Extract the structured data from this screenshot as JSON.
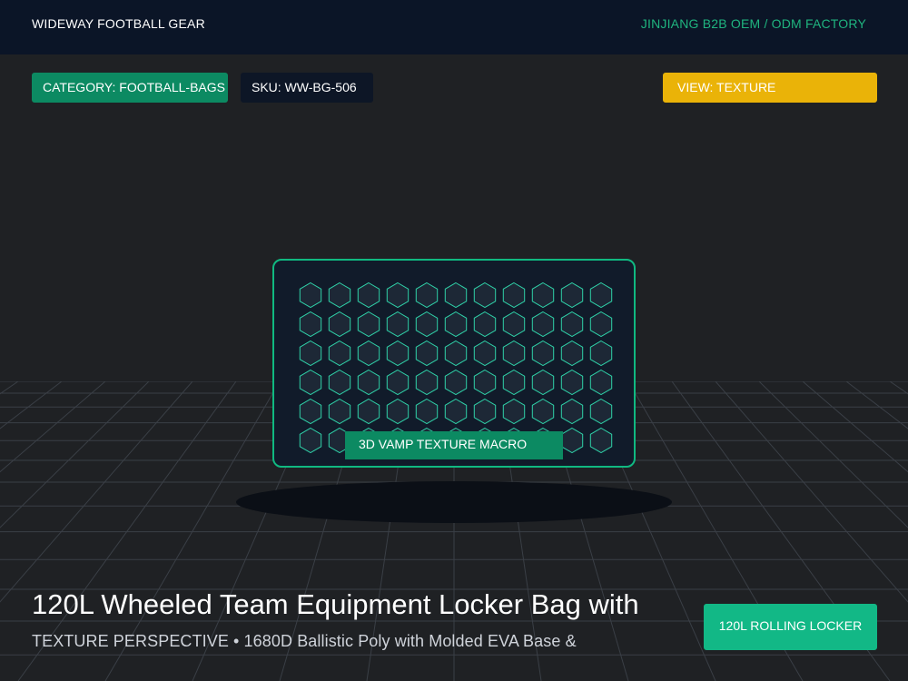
{
  "header": {
    "brand": "WIDEWAY FOOTBALL GEAR",
    "factory": "JINJIANG B2B OEM / ODM FACTORY"
  },
  "chips": {
    "category": "CATEGORY: FOOTBALL-BAGS",
    "sku": "SKU: WW-BG-506",
    "view": "VIEW: TEXTURE"
  },
  "viewer": {
    "pattern": "hexagon-texture",
    "label": "3D VAMP TEXTURE MACRO"
  },
  "product": {
    "title": "120L Wheeled Team Equipment Locker Bag with",
    "subtitle": "TEXTURE PERSPECTIVE • 1680D Ballistic Poly with Molded EVA Base &",
    "cta": "120L ROLLING LOCKER"
  },
  "colors": {
    "accent_green": "#10b981",
    "accent_yellow": "#eab308",
    "header_bg": "#0b1527"
  }
}
